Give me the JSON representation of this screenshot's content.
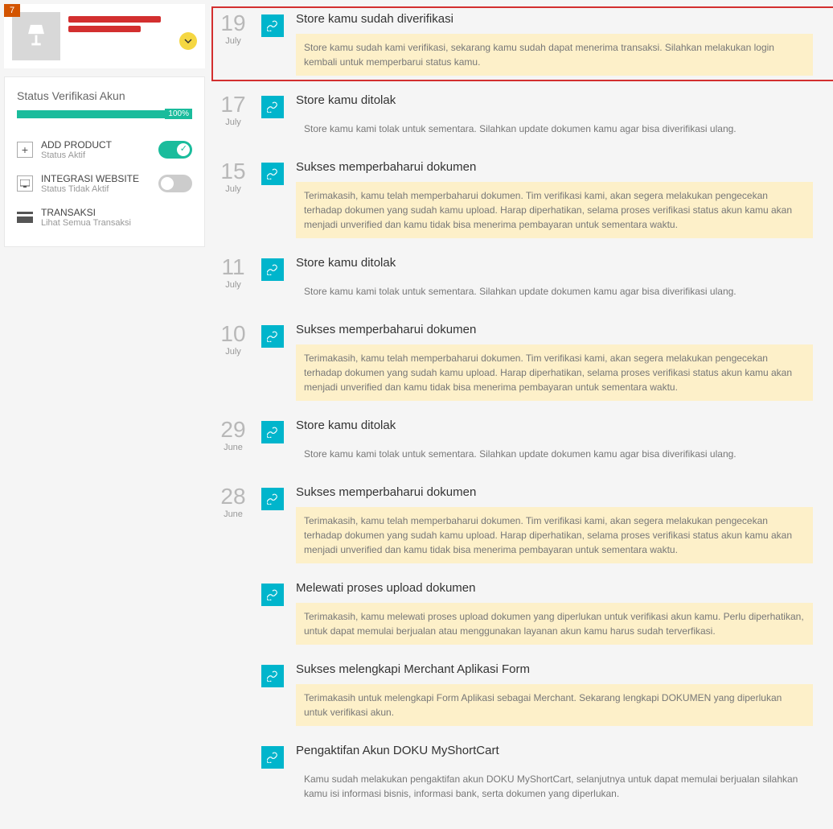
{
  "sidebar": {
    "badge": "7",
    "status_title": "Status Verifikasi Akun",
    "progress": "100%",
    "items": [
      {
        "title": "ADD PRODUCT",
        "sub": "Status Aktif",
        "toggle": "on",
        "icon": "plus"
      },
      {
        "title": "INTEGRASI WEBSITE",
        "sub": "Status Tidak Aktif",
        "toggle": "off",
        "icon": "monitor"
      },
      {
        "title": "TRANSAKSI",
        "sub": "Lihat Semua Transaksi",
        "toggle": null,
        "icon": "card"
      }
    ]
  },
  "timeline": [
    {
      "day": "19",
      "month": "July",
      "title": "Store kamu sudah diverifikasi",
      "desc": "Store kamu sudah kami verifikasi, sekarang kamu sudah dapat menerima transaksi. Silahkan melakukan login kembali untuk memperbarui status kamu.",
      "highlight": true,
      "boxed": true
    },
    {
      "day": "17",
      "month": "July",
      "title": "Store kamu ditolak",
      "desc": "Store kamu kami tolak untuk sementara. Silahkan update dokumen kamu agar bisa diverifikasi ulang.",
      "highlight": false
    },
    {
      "day": "15",
      "month": "July",
      "title": "Sukses memperbaharui dokumen",
      "desc": "Terimakasih, kamu telah memperbaharui dokumen. Tim verifikasi kami, akan segera melakukan pengecekan terhadap dokumen yang sudah kamu upload. Harap diperhatikan, selama proses verifikasi status akun kamu akan menjadi unverified dan kamu tidak bisa menerima pembayaran untuk sementara waktu.",
      "highlight": true
    },
    {
      "day": "11",
      "month": "July",
      "title": "Store kamu ditolak",
      "desc": "Store kamu kami tolak untuk sementara. Silahkan update dokumen kamu agar bisa diverifikasi ulang.",
      "highlight": false
    },
    {
      "day": "10",
      "month": "July",
      "title": "Sukses memperbaharui dokumen",
      "desc": "Terimakasih, kamu telah memperbaharui dokumen. Tim verifikasi kami, akan segera melakukan pengecekan terhadap dokumen yang sudah kamu upload. Harap diperhatikan, selama proses verifikasi status akun kamu akan menjadi unverified dan kamu tidak bisa menerima pembayaran untuk sementara waktu.",
      "highlight": true
    },
    {
      "day": "29",
      "month": "June",
      "title": "Store kamu ditolak",
      "desc": "Store kamu kami tolak untuk sementara. Silahkan update dokumen kamu agar bisa diverifikasi ulang.",
      "highlight": false
    },
    {
      "day": "28",
      "month": "June",
      "title": "Sukses memperbaharui dokumen",
      "desc": "Terimakasih, kamu telah memperbaharui dokumen. Tim verifikasi kami, akan segera melakukan pengecekan terhadap dokumen yang sudah kamu upload. Harap diperhatikan, selama proses verifikasi status akun kamu akan menjadi unverified dan kamu tidak bisa menerima pembayaran untuk sementara waktu.",
      "highlight": true
    },
    {
      "day": "",
      "month": "",
      "title": "Melewati proses upload dokumen",
      "desc": "Terimakasih, kamu melewati proses upload dokumen yang diperlukan untuk verifikasi akun kamu. Perlu diperhatikan, untuk dapat memulai berjualan atau menggunakan layanan akun kamu harus sudah terverfikasi.",
      "highlight": true
    },
    {
      "day": "",
      "month": "",
      "title": "Sukses melengkapi Merchant Aplikasi Form",
      "desc": "Terimakasih untuk melengkapi Form Aplikasi sebagai Merchant. Sekarang lengkapi DOKUMEN yang diperlukan untuk verifikasi akun.",
      "highlight": true
    },
    {
      "day": "",
      "month": "",
      "title": "Pengaktifan Akun DOKU MyShortCart",
      "desc": "Kamu sudah melakukan pengaktifan akun DOKU MyShortCart, selanjutnya untuk dapat memulai berjualan silahkan kamu isi informasi bisnis, informasi bank, serta dokumen yang diperlukan.",
      "highlight": false
    }
  ]
}
